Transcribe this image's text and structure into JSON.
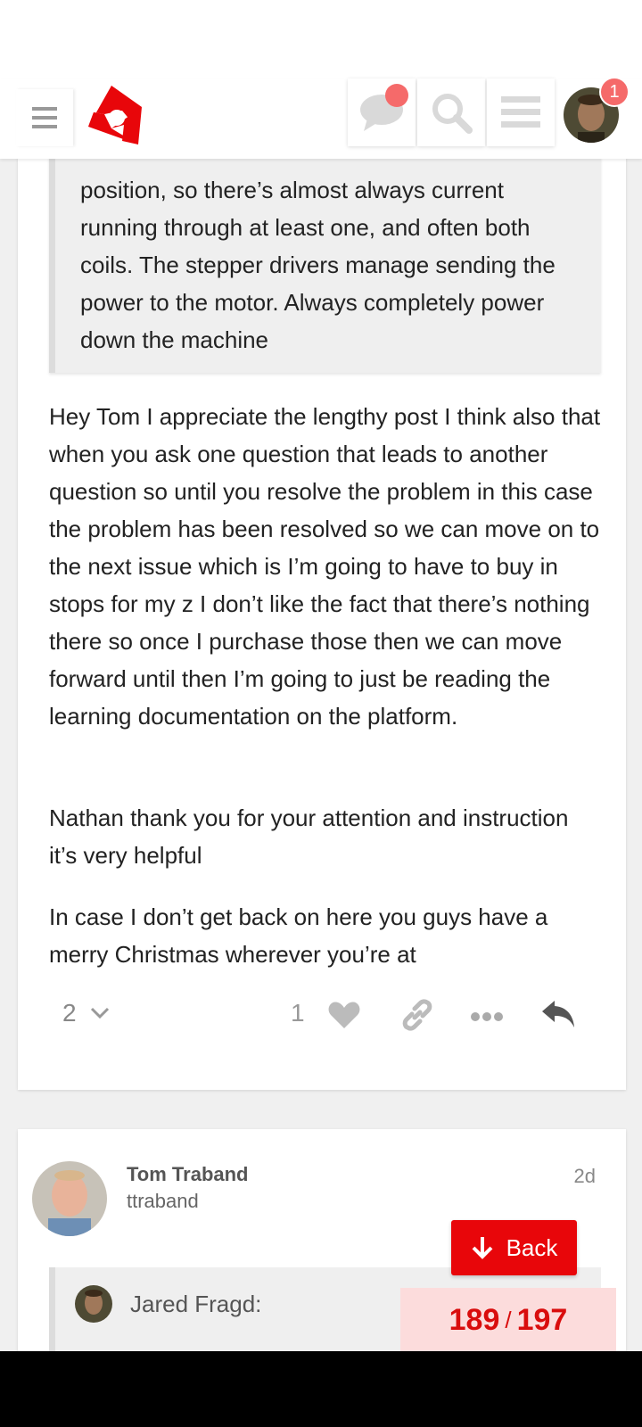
{
  "colors": {
    "brand": "#e8060a",
    "notification": "#f56a6a",
    "quote_bg": "#efefef",
    "progress_bg": "#fcdcdc"
  },
  "header": {
    "icons": [
      "hamburger-icon",
      "logo",
      "chat-icon",
      "search-icon",
      "menu-icon",
      "avatar"
    ],
    "notification_count": "1"
  },
  "post": {
    "quote_text": "position, so there’s almost always current running through at least one, and often both coils. The stepper drivers manage sending the power to the motor. Always completely power down the machine",
    "paragraphs": [
      "Hey Tom I appreciate the lengthy post I think also that when you ask one question that leads to another question so until you resolve the problem in this case the problem has been resolved so we can move on to the next issue which is I’m going to have to buy in stops for my z I don’t like the fact that there’s nothing there so once I purchase those then we can move forward until then I’m going to just be reading the learning documentation on the platform.",
      "Nathan thank you for your attention and instruction it’s very helpful",
      "In case I don’t get back on here you guys have a merry Christmas wherever you’re at"
    ],
    "actions": {
      "replies": "2",
      "likes": "1"
    }
  },
  "next_post": {
    "author_name": "Tom Traband",
    "username": "ttraband",
    "date": "2d",
    "quote_author": "Jared Fragd:"
  },
  "back_button": {
    "label": "Back"
  },
  "progress": {
    "current": "189",
    "separator": "/",
    "total": "197"
  }
}
